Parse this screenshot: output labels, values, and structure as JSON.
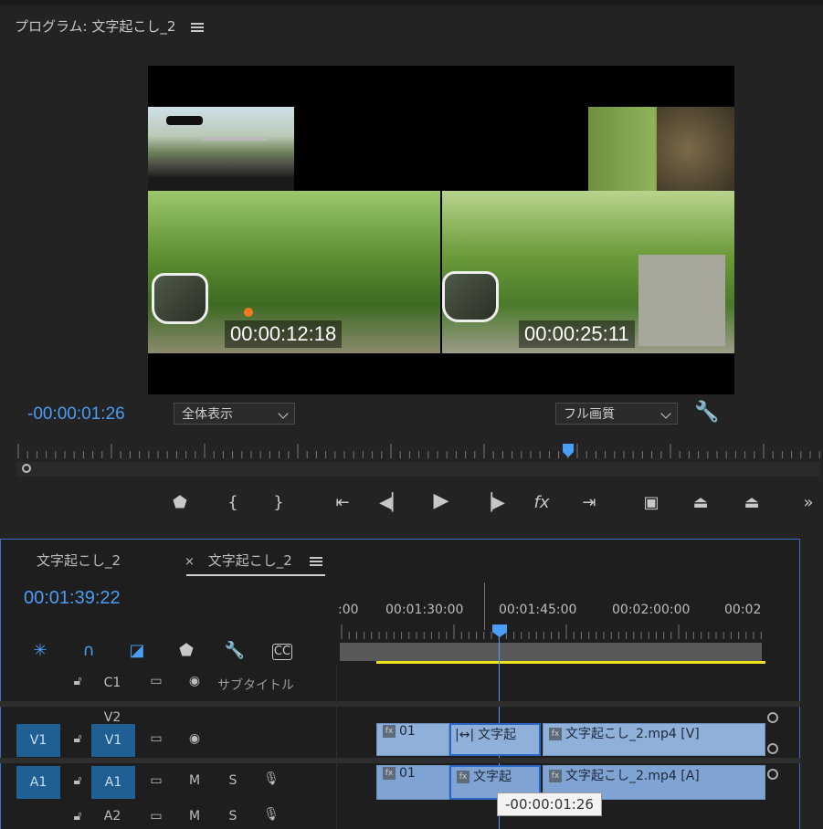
{
  "program_monitor": {
    "title": "プログラム: 文字起こし_2",
    "overlays": [
      "00:00:12:18",
      "00:00:25:11"
    ],
    "current_time": "-00:00:01:26",
    "zoom_select": "全体表示",
    "quality_select": "フル画質"
  },
  "timeline": {
    "tabs": [
      "文字起こし_2",
      "文字起こし_2"
    ],
    "close_symbol": "×",
    "timecode": "00:01:39:22",
    "ruler_labels": [
      ":00",
      "00:01:30:00",
      "00:01:45:00",
      "00:02:00:00",
      "00:02"
    ],
    "tracks": {
      "c1": {
        "label": "C1",
        "name": "サブタイトル"
      },
      "v2": {
        "label": "V2"
      },
      "v1": {
        "source": "V1",
        "label": "V1"
      },
      "a1": {
        "source": "A1",
        "label": "A1",
        "m": "M",
        "s": "S"
      },
      "a2": {
        "label": "A2",
        "m": "M",
        "s": "S"
      }
    },
    "clips": {
      "v_clip1": "01",
      "v_clip2": "文字起",
      "v_clip3": "文字起こし_2.mp4 [V]",
      "a_clip1": "01",
      "a_clip2": "文字起",
      "a_clip3": "文字起こし_2.mp4 [A]"
    },
    "tooltip": "-00:00:01:26"
  },
  "colors": {
    "accent": "#4b9cf5",
    "track_active": "#1f5f93",
    "clip": "#8fb0d9",
    "work_area": "#f0e11e"
  }
}
